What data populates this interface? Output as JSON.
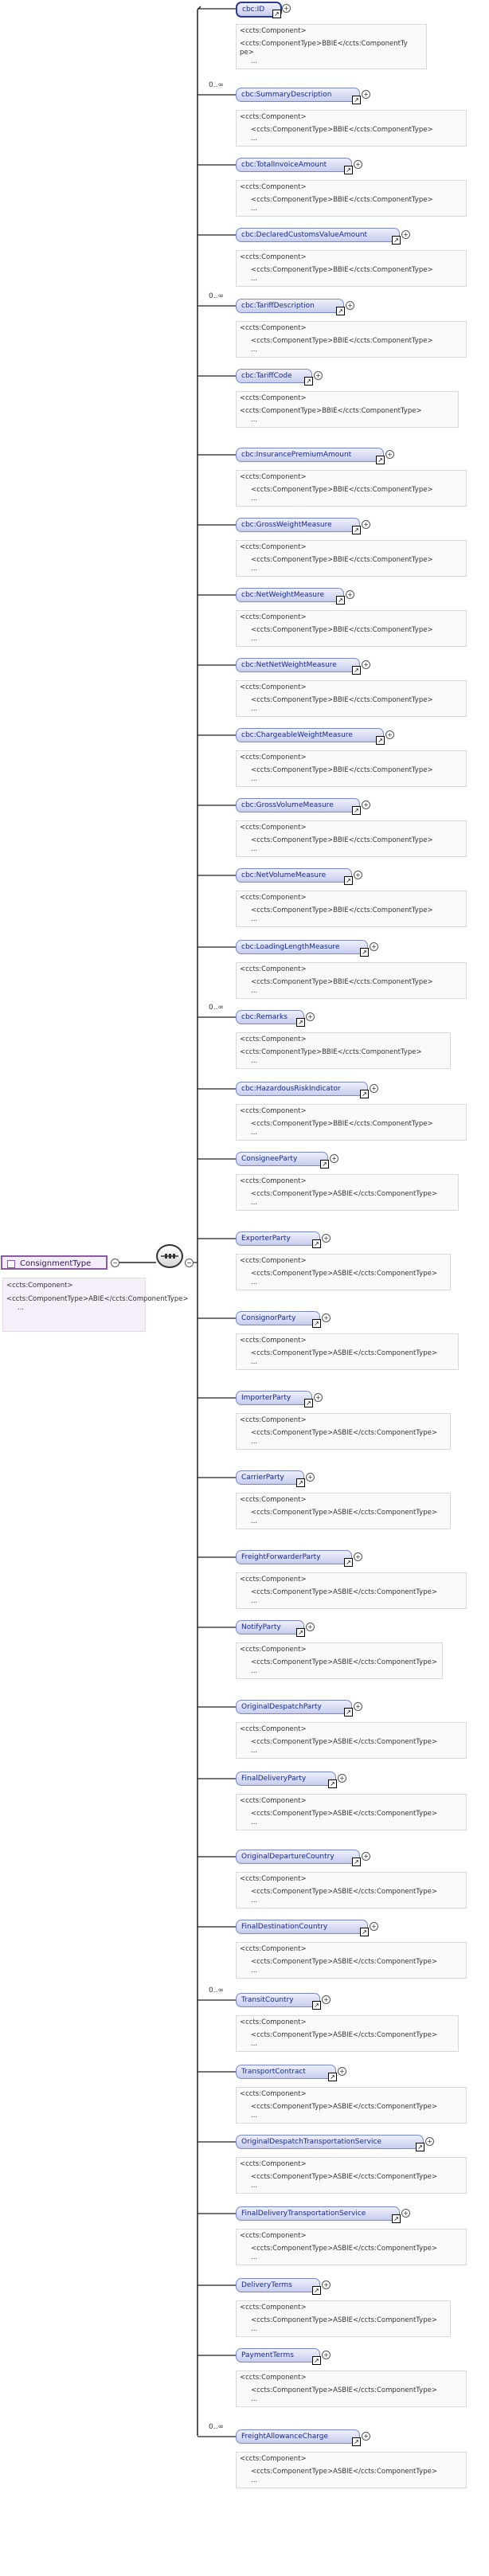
{
  "root": {
    "name": "ConsignmentType",
    "annotation": [
      "<ccts:Component>",
      "<ccts:ComponentType>ABIE</ccts:ComponentType>",
      "..."
    ]
  },
  "sequence_icon": "sequence-compositor-icon",
  "elements": [
    {
      "name": "cbc:ID",
      "card": "",
      "ann": [
        "<ccts:Component>",
        "<ccts:ComponentType>BBIE</ccts:ComponentTy",
        "pe>",
        "..."
      ]
    },
    {
      "name": "cbc:SummaryDescription",
      "card": "0..∞",
      "ann": [
        "<ccts:Component>",
        "<ccts:ComponentType>BBIE</ccts:ComponentType>",
        "..."
      ]
    },
    {
      "name": "cbc:TotalInvoiceAmount",
      "card": "",
      "ann": [
        "<ccts:Component>",
        "<ccts:ComponentType>BBIE</ccts:ComponentType>",
        "..."
      ]
    },
    {
      "name": "cbc:DeclaredCustomsValueAmount",
      "card": "",
      "ann": [
        "<ccts:Component>",
        "<ccts:ComponentType>BBIE</ccts:ComponentType>",
        "..."
      ]
    },
    {
      "name": "cbc:TariffDescription",
      "card": "0..∞",
      "ann": [
        "<ccts:Component>",
        "<ccts:ComponentType>BBIE</ccts:ComponentType>",
        "..."
      ]
    },
    {
      "name": "cbc:TariffCode",
      "card": "",
      "ann": [
        "<ccts:Component>",
        "<ccts:ComponentType>BBIE</ccts:ComponentType>",
        "..."
      ]
    },
    {
      "name": "cbc:InsurancePremiumAmount",
      "card": "",
      "ann": [
        "<ccts:Component>",
        "<ccts:ComponentType>BBIE</ccts:ComponentType>",
        "..."
      ]
    },
    {
      "name": "cbc:GrossWeightMeasure",
      "card": "",
      "ann": [
        "<ccts:Component>",
        "<ccts:ComponentType>BBIE</ccts:ComponentType>",
        "..."
      ]
    },
    {
      "name": "cbc:NetWeightMeasure",
      "card": "",
      "ann": [
        "<ccts:Component>",
        "<ccts:ComponentType>BBIE</ccts:ComponentType>",
        "..."
      ]
    },
    {
      "name": "cbc:NetNetWeightMeasure",
      "card": "",
      "ann": [
        "<ccts:Component>",
        "<ccts:ComponentType>BBIE</ccts:ComponentType>",
        "..."
      ]
    },
    {
      "name": "cbc:ChargeableWeightMeasure",
      "card": "",
      "ann": [
        "<ccts:Component>",
        "<ccts:ComponentType>BBIE</ccts:ComponentType>",
        "..."
      ]
    },
    {
      "name": "cbc:GrossVolumeMeasure",
      "card": "",
      "ann": [
        "<ccts:Component>",
        "<ccts:ComponentType>BBIE</ccts:ComponentType>",
        "..."
      ]
    },
    {
      "name": "cbc:NetVolumeMeasure",
      "card": "",
      "ann": [
        "<ccts:Component>",
        "<ccts:ComponentType>BBIE</ccts:ComponentType>",
        "..."
      ]
    },
    {
      "name": "cbc:LoadingLengthMeasure",
      "card": "",
      "ann": [
        "<ccts:Component>",
        "<ccts:ComponentType>BBIE</ccts:ComponentType>",
        "..."
      ]
    },
    {
      "name": "cbc:Remarks",
      "card": "0..∞",
      "ann": [
        "<ccts:Component>",
        "<ccts:ComponentType>BBIE</ccts:ComponentType>",
        "..."
      ]
    },
    {
      "name": "cbc:HazardousRiskIndicator",
      "card": "",
      "ann": [
        "<ccts:Component>",
        "<ccts:ComponentType>BBIE</ccts:ComponentType>",
        "..."
      ]
    },
    {
      "name": "ConsigneeParty",
      "card": "",
      "ann": [
        "<ccts:Component>",
        "<ccts:ComponentType>ASBIE</ccts:ComponentType>",
        "..."
      ]
    },
    {
      "name": "ExporterParty",
      "card": "",
      "ann": [
        "<ccts:Component>",
        "<ccts:ComponentType>ASBIE</ccts:ComponentType>",
        "..."
      ]
    },
    {
      "name": "ConsignorParty",
      "card": "",
      "ann": [
        "<ccts:Component>",
        "<ccts:ComponentType>ASBIE</ccts:ComponentType>",
        "..."
      ]
    },
    {
      "name": "ImporterParty",
      "card": "",
      "ann": [
        "<ccts:Component>",
        "<ccts:ComponentType>ASBIE</ccts:ComponentType>",
        "..."
      ]
    },
    {
      "name": "CarrierParty",
      "card": "",
      "ann": [
        "<ccts:Component>",
        "<ccts:ComponentType>ASBIE</ccts:ComponentType>",
        "..."
      ]
    },
    {
      "name": "FreightForwarderParty",
      "card": "",
      "ann": [
        "<ccts:Component>",
        "<ccts:ComponentType>ASBIE</ccts:ComponentType>",
        "..."
      ]
    },
    {
      "name": "NotifyParty",
      "card": "",
      "ann": [
        "<ccts:Component>",
        "<ccts:ComponentType>ASBIE</ccts:ComponentType>",
        "..."
      ]
    },
    {
      "name": "OriginalDespatchParty",
      "card": "",
      "ann": [
        "<ccts:Component>",
        "<ccts:ComponentType>ASBIE</ccts:ComponentType>",
        "..."
      ]
    },
    {
      "name": "FinalDeliveryParty",
      "card": "",
      "ann": [
        "<ccts:Component>",
        "<ccts:ComponentType>ASBIE</ccts:ComponentType>",
        "..."
      ]
    },
    {
      "name": "OriginalDepartureCountry",
      "card": "",
      "ann": [
        "<ccts:Component>",
        "<ccts:ComponentType>ASBIE</ccts:ComponentType>",
        "..."
      ]
    },
    {
      "name": "FinalDestinationCountry",
      "card": "",
      "ann": [
        "<ccts:Component>",
        "<ccts:ComponentType>ASBIE</ccts:ComponentType>",
        "..."
      ]
    },
    {
      "name": "TransitCountry",
      "card": "0..∞",
      "ann": [
        "<ccts:Component>",
        "<ccts:ComponentType>ASBIE</ccts:ComponentType>",
        "..."
      ]
    },
    {
      "name": "TransportContract",
      "card": "",
      "ann": [
        "<ccts:Component>",
        "<ccts:ComponentType>ASBIE</ccts:ComponentType>",
        "..."
      ]
    },
    {
      "name": "OriginalDespatchTransportationService",
      "card": "",
      "ann": [
        "<ccts:Component>",
        "<ccts:ComponentType>ASBIE</ccts:ComponentType>",
        "..."
      ]
    },
    {
      "name": "FinalDeliveryTransportationService",
      "card": "",
      "ann": [
        "<ccts:Component>",
        "<ccts:ComponentType>ASBIE</ccts:ComponentType>",
        "..."
      ]
    },
    {
      "name": "DeliveryTerms",
      "card": "",
      "ann": [
        "<ccts:Component>",
        "<ccts:ComponentType>ASBIE</ccts:ComponentType>",
        "..."
      ]
    },
    {
      "name": "PaymentTerms",
      "card": "",
      "ann": [
        "<ccts:Component>",
        "<ccts:ComponentType>ASBIE</ccts:ComponentType>",
        "..."
      ]
    },
    {
      "name": "FreightAllowanceCharge",
      "card": "0..∞",
      "ann": [
        "<ccts:Component>",
        "<ccts:ComponentType>ASBIE</ccts:ComponentType>",
        "..."
      ]
    }
  ]
}
